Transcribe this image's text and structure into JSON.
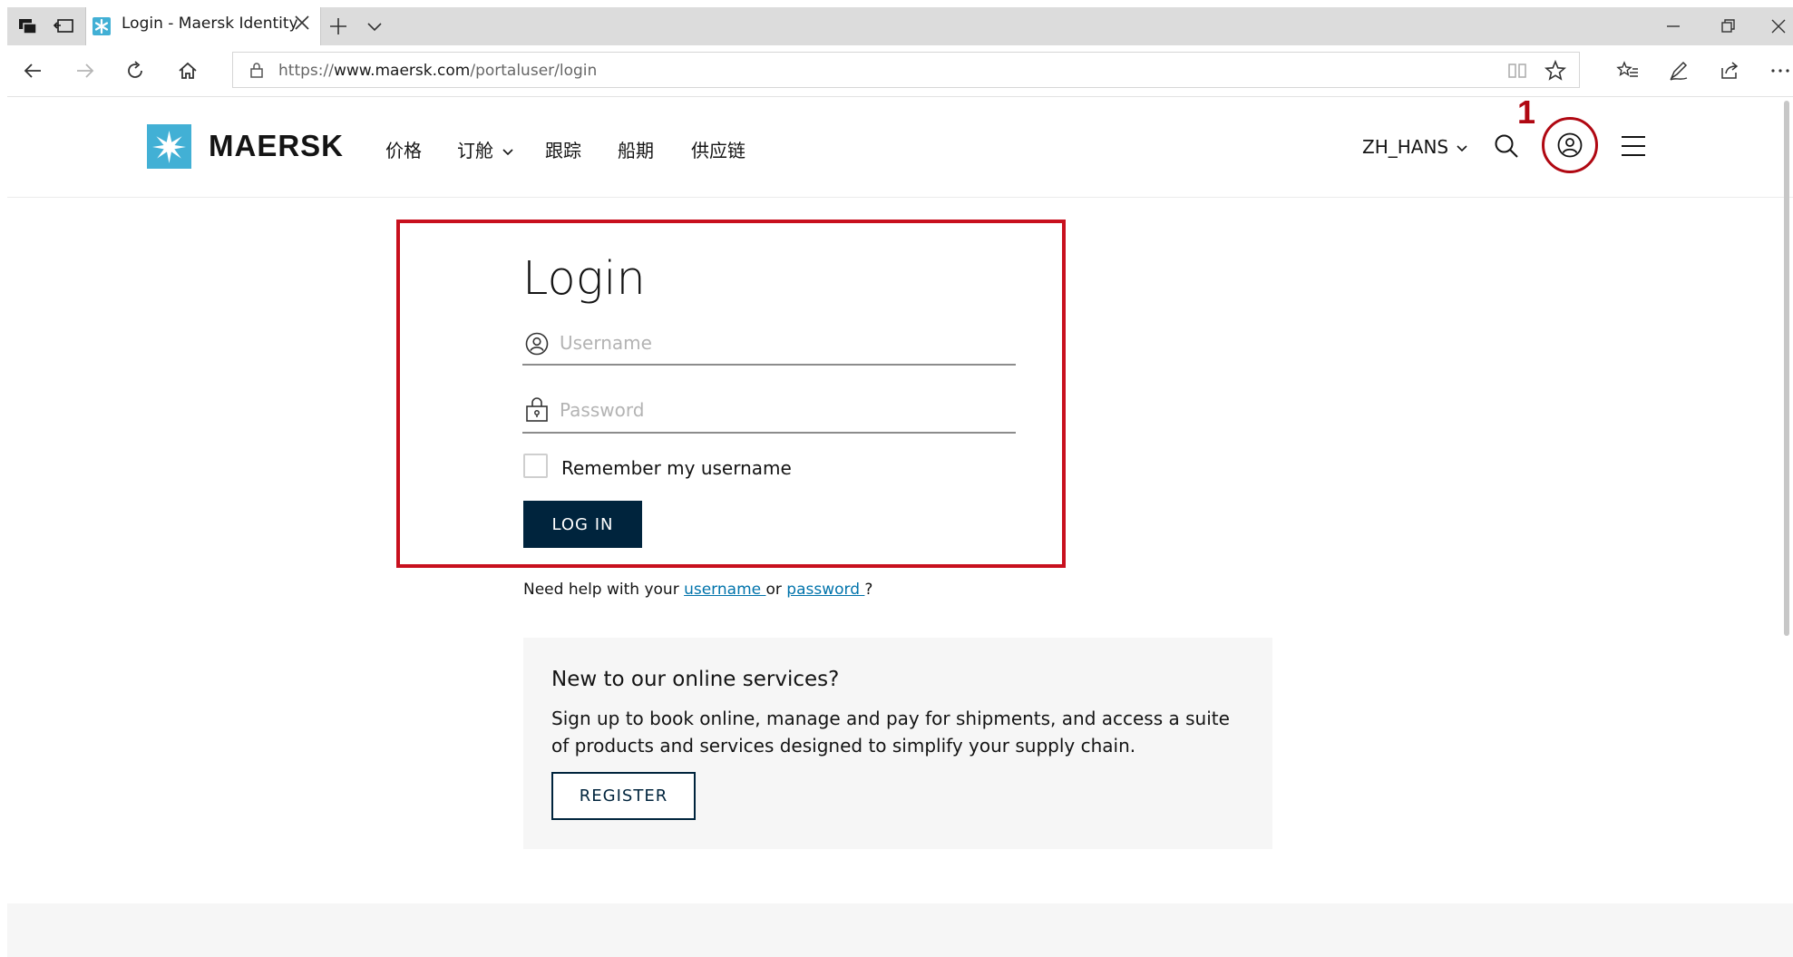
{
  "browser": {
    "tab_title": "Login - Maersk Identity",
    "url_scheme": "https://",
    "url_host": "www.maersk.com",
    "url_path": "/portaluser/login",
    "icons": [
      "tab-actions-icon",
      "set-aside-tabs-icon",
      "new-tab-icon",
      "tab-list-icon",
      "minimize-icon",
      "restore-icon",
      "window-close-icon",
      "back-icon",
      "forward-icon",
      "refresh-icon",
      "home-icon",
      "lock-icon",
      "reading-view-icon",
      "favorite-star-icon",
      "favorites-list-icon",
      "pen-icon",
      "share-icon",
      "more-icon"
    ]
  },
  "header": {
    "logo_text": "MAERSK",
    "nav": [
      {
        "label": "价格"
      },
      {
        "label": "订舱",
        "has_dropdown": true
      },
      {
        "label": "跟踪"
      },
      {
        "label": "船期"
      },
      {
        "label": "供应链"
      }
    ],
    "language": "ZH_HANS",
    "annotation_number": "1"
  },
  "login": {
    "title": "Login",
    "username_placeholder": "Username",
    "password_placeholder": "Password",
    "remember_label": "Remember my username",
    "login_button": "LOG IN",
    "help_prefix": "Need help with your ",
    "help_username_link": "username ",
    "help_or": "or ",
    "help_password_link": "password ",
    "help_suffix": "?"
  },
  "register": {
    "title": "New to our online services?",
    "text": "Sign up to book online, manage and pay for shipments, and access a suite of products and services designed to simplify your supply chain.",
    "button": "REGISTER"
  },
  "colors": {
    "brand_blue": "#42b0d5",
    "navy": "#00243d",
    "annotation_red": "#c8101e",
    "link": "#0073ab"
  }
}
